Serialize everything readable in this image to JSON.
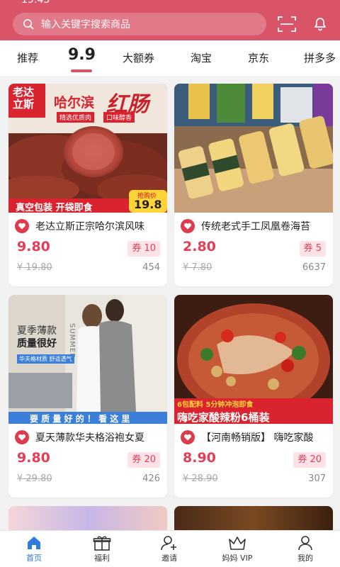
{
  "status": {
    "time": "19:45"
  },
  "search": {
    "placeholder": "输入关键字搜索商品"
  },
  "tabs": [
    {
      "label": "推荐"
    },
    {
      "label": "9.9"
    },
    {
      "label": "大额券"
    },
    {
      "label": "淘宝"
    },
    {
      "label": "京东"
    },
    {
      "label": "拼多多"
    }
  ],
  "products": [
    {
      "title": "老达立斯正宗哈尔滨风味",
      "price": "9.80",
      "coupon": "券 10",
      "orig": "¥ 19.80",
      "sold": "454",
      "img_text": {
        "brand": "老达\n立斯",
        "name": "哈尔滨",
        "script": "红肠",
        "tag1": "精选优质肉",
        "tag2": "口味醇香",
        "banner": "真空包装  开袋即食",
        "price_tag": "抢购价",
        "price_val": "19.8"
      }
    },
    {
      "title": "传统老式手工凤凰卷海苔",
      "price": "2.80",
      "coupon": "券 5",
      "orig": "¥ 7.80",
      "sold": "6637"
    },
    {
      "title": "夏天薄款华夫格浴袍女夏",
      "price": "9.80",
      "coupon": "券 20",
      "orig": "¥ 29.80",
      "sold": "426",
      "img_text": {
        "head": "夏季薄款",
        "sub": "质量很好",
        "summer": "SUMMER",
        "chip": "华夫格材质 舒适透气",
        "banner": "要 质 量 好 的 ！ 看 这 里"
      }
    },
    {
      "title": "【河南畅销版】 嗨吃家酸",
      "price": "8.90",
      "coupon": "券 20",
      "orig": "¥ 28.90",
      "sold": "307",
      "img_text": {
        "top": "6包配料  5分钟冲泡即食",
        "banner": "嗨吃家酸辣粉6桶装"
      }
    }
  ],
  "nav": [
    {
      "label": "首页",
      "icon": "home-icon",
      "active": true
    },
    {
      "label": "福利",
      "icon": "gift-icon"
    },
    {
      "label": "邀请",
      "icon": "invite-icon"
    },
    {
      "label": "妈妈 VIP",
      "icon": "crown-icon"
    },
    {
      "label": "我的",
      "icon": "profile-icon"
    }
  ],
  "colors": {
    "brand": "#d95468",
    "price": "#e33d57",
    "nav_active": "#2e7be0"
  }
}
